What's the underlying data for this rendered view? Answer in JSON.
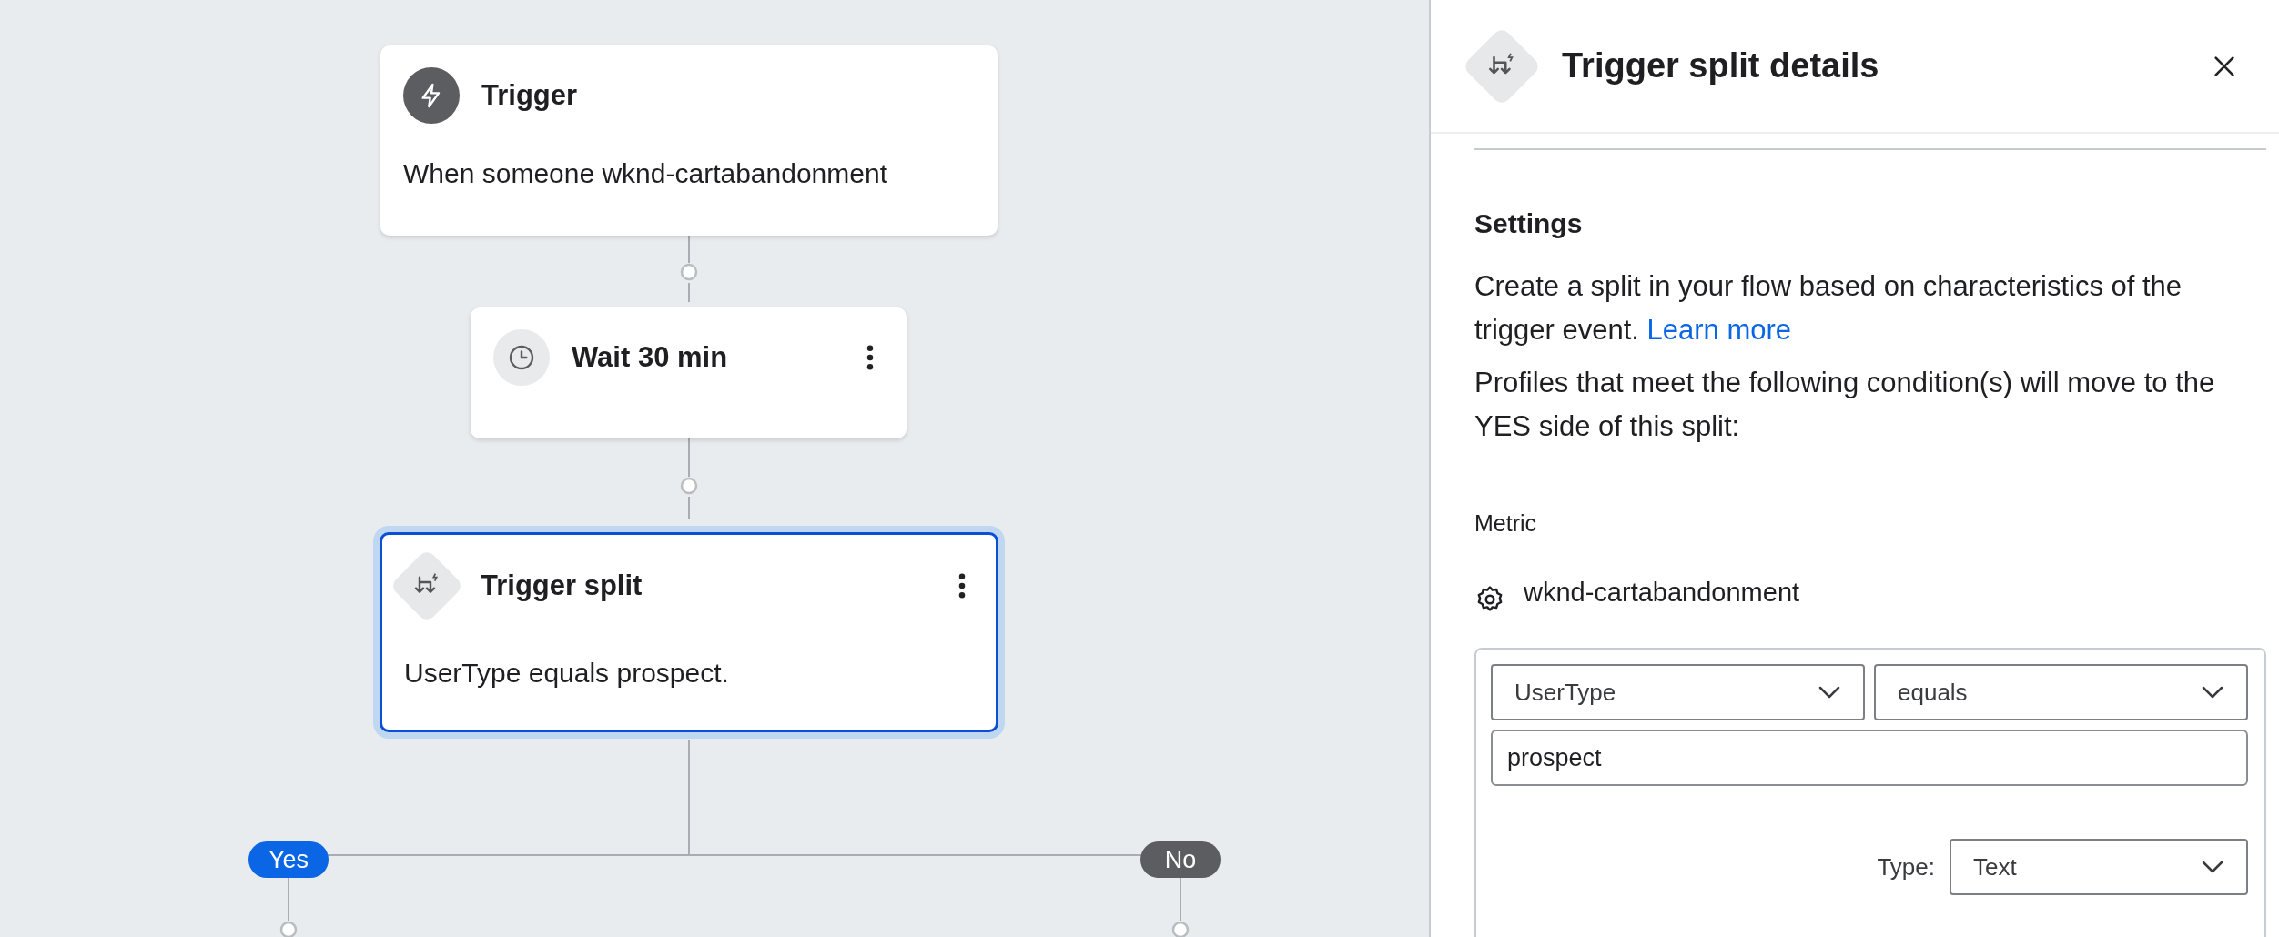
{
  "canvas": {
    "nodes": [
      {
        "kind": "trigger",
        "title": "Trigger",
        "description": "When someone wknd-cartabandonment",
        "has_menu": false,
        "selected": false
      },
      {
        "kind": "wait",
        "title": "Wait 30 min",
        "has_menu": true,
        "selected": false
      },
      {
        "kind": "split",
        "title": "Trigger split",
        "description": "UserType equals prospect.",
        "has_menu": true,
        "selected": true
      }
    ],
    "branches": [
      {
        "kind": "yes",
        "label": "Yes"
      },
      {
        "kind": "no",
        "label": "No"
      }
    ]
  },
  "panel": {
    "title": "Trigger split details",
    "section": "Settings",
    "description": "Create a split in your flow based on characteristics of the trigger event.",
    "link": "Learn more",
    "conditions_intro": "Profiles that meet the following condition(s) will move to the YES side of this split:",
    "metric_label": "Metric",
    "metric": "wknd-cartabandonment",
    "condition": {
      "property": "UserType",
      "operator": "equals",
      "value": "prospect",
      "type_label": "Type:",
      "type": "Text"
    }
  }
}
